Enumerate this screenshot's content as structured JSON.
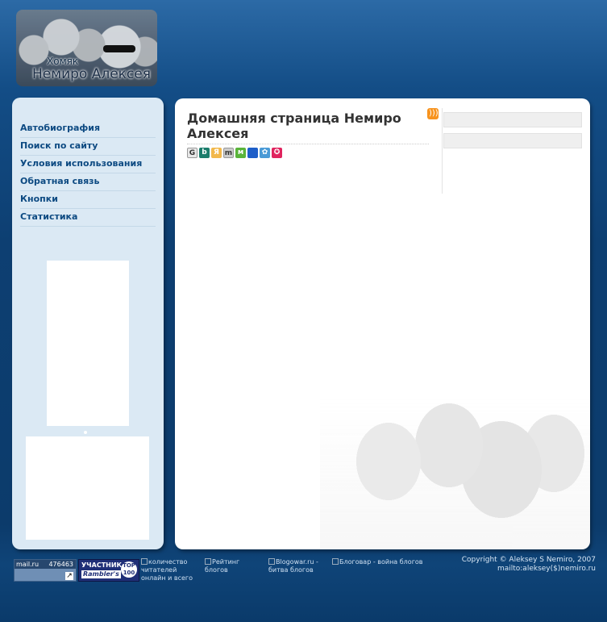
{
  "header": {
    "logo_small_text": "Хомяк",
    "logo_name_text": "Немиро Алексея"
  },
  "sidebar": {
    "items": [
      {
        "label": "Автобиография"
      },
      {
        "label": "Поиск по сайту"
      },
      {
        "label": "Условия использования"
      },
      {
        "label": "Обратная связь"
      },
      {
        "label": "Кнопки"
      },
      {
        "label": "Статистика"
      }
    ]
  },
  "main": {
    "title": "Домашняя страница Немиро Алексея",
    "rss_icon": "rss-icon",
    "social_icons": [
      {
        "name": "google-bookmarks-icon",
        "glyph": "G",
        "color": "#e8e8e8"
      },
      {
        "name": "bobrdobr-icon",
        "glyph": "b",
        "color": "#1c7d6c"
      },
      {
        "name": "yandex-bookmarks-icon",
        "glyph": "Я",
        "color": "#f2b84b"
      },
      {
        "name": "memori-icon",
        "glyph": "m",
        "color": "#cccccc"
      },
      {
        "name": "moemesto-icon",
        "glyph": "м",
        "color": "#5ab43a"
      },
      {
        "name": "delicious-icon",
        "glyph": "",
        "color": "#1d5ec8"
      },
      {
        "name": "digg-paw-icon",
        "glyph": "✿",
        "color": "#4a9ad6"
      },
      {
        "name": "smi2-icon",
        "glyph": "✪",
        "color": "#e0245e"
      }
    ]
  },
  "footer": {
    "mailru": {
      "label": "mail.ru",
      "count": "476463"
    },
    "rambler": {
      "line1": "УЧАСТНИК",
      "line2": "Rambler's",
      "badge": "TOP 100"
    },
    "readers_alt": "количество читателей онлайн и всего",
    "rating_alt": "Рейтинг блогов",
    "blogowar_alt": "Blogowar.ru - битва блогов",
    "blogowar2_alt": "Блоговар - война блогов",
    "copyright_line1": "Copyright © Aleksey S Nemiro, 2007",
    "copyright_line2": "mailto:aleksey($)nemiro.ru"
  },
  "colors": {
    "accent": "#0d4a82",
    "background_top": "#2c6aa6",
    "background_main": "#0d3f72"
  }
}
